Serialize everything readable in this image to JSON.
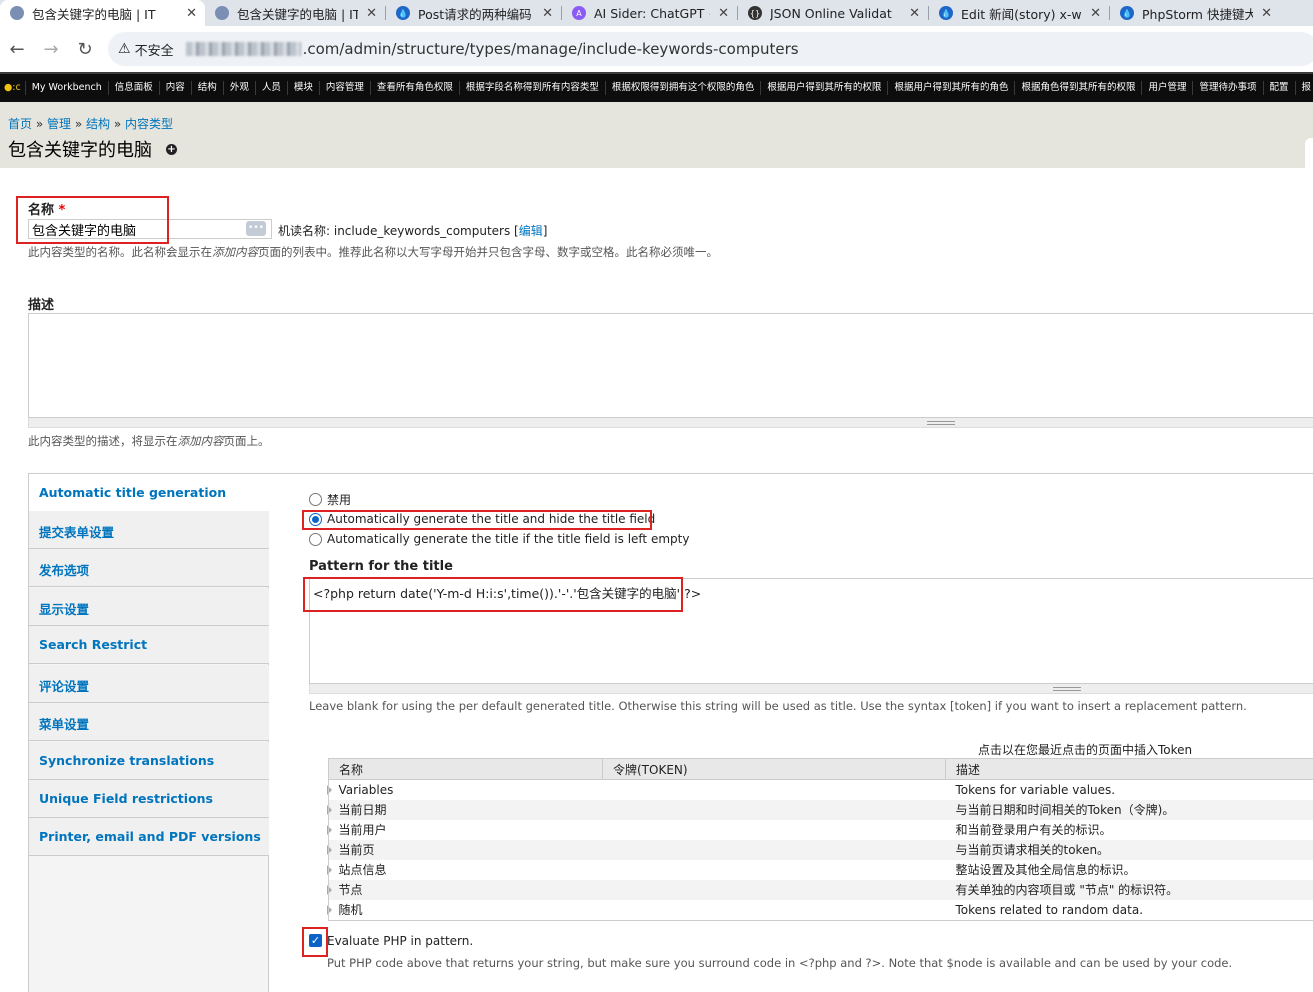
{
  "browser": {
    "tabs": [
      {
        "title": "包含关键字的电脑 | IT",
        "active": true,
        "favicon": "site-icon"
      },
      {
        "title": "包含关键字的电脑 | IT",
        "active": false,
        "favicon": "site-icon"
      },
      {
        "title": "Post请求的两种编码",
        "active": false,
        "favicon": "drupal-icon"
      },
      {
        "title": "AI Sider: ChatGPT +",
        "active": false,
        "favicon": "sider-icon"
      },
      {
        "title": "JSON Online Validat",
        "active": false,
        "favicon": "json-icon"
      },
      {
        "title": "Edit 新闻(story) x-w",
        "active": false,
        "favicon": "drupal-icon"
      },
      {
        "title": "PhpStorm 快捷键大全",
        "active": false,
        "favicon": "drupal-icon"
      }
    ],
    "insecure_label": "不安全",
    "url": ".com/admin/structure/types/manage/include-keywords-computers"
  },
  "admin_menu": [
    "My Workbench",
    "信息面板",
    "内容",
    "结构",
    "外观",
    "人员",
    "模块",
    "内容管理",
    "查看所有角色权限",
    "根据字段名称得到所有内容类型",
    "根据权限得到拥有这个权限的角色",
    "根据用户得到其所有的权限",
    "根据用户得到其所有的角色",
    "根据角色得到其所有的权限",
    "用户管理",
    "管理待办事项",
    "配置",
    "报"
  ],
  "breadcrumb": {
    "items": [
      "首页",
      "管理",
      "结构",
      "内容类型"
    ],
    "separator": " » "
  },
  "page_title": "包含关键字的电脑",
  "name_field": {
    "label": "名称",
    "required_marker": "*",
    "value": "包含关键字的电脑",
    "machine_name_prefix": "机读名称: ",
    "machine_name": "include_keywords_computers",
    "edit_link": "编辑",
    "desc_before": "此内容类型的名称。此名称会显示在",
    "desc_em": "添加内容",
    "desc_after": "页面的列表中。推荐此名称以大写字母开始并只包含字母、数字或空格。此名称必须唯一。"
  },
  "description_field": {
    "label": "描述",
    "value": "",
    "desc_before": "此内容类型的描述，将显示在",
    "desc_em": "添加内容",
    "desc_after": "页面上。"
  },
  "vertical_tabs": [
    "Automatic title generation",
    "提交表单设置",
    "发布选项",
    "显示设置",
    "Search Restrict",
    "评论设置",
    "菜单设置",
    "Synchronize translations",
    "Unique Field restrictions",
    "Printer, email and PDF versions"
  ],
  "auto_title": {
    "options": [
      {
        "label": "禁用",
        "checked": false
      },
      {
        "label": "Automatically generate the title and hide the title field",
        "checked": true
      },
      {
        "label": "Automatically generate the title if the title field is left empty",
        "checked": false
      }
    ],
    "pattern_label": "Pattern for the title",
    "pattern_value": "<?php return date('Y-m-d H:i:s',time()).'-'.'包含关键字的电脑' ?>",
    "pattern_desc": "Leave blank for using the per default generated title. Otherwise this string will be used as title. Use the syntax [token] if you want to insert a replacement pattern.",
    "token_hint": "点击以在您最近点击的页面中插入Token",
    "token_table": {
      "headers": [
        "名称",
        "令牌(TOKEN)",
        "描述"
      ],
      "rows": [
        {
          "name": "Variables",
          "token": "",
          "desc": "Tokens for variable values."
        },
        {
          "name": "当前日期",
          "token": "",
          "desc": "与当前日期和时间相关的Token（令牌)。"
        },
        {
          "name": "当前用户",
          "token": "",
          "desc": "和当前登录用户有关的标识。"
        },
        {
          "name": "当前页",
          "token": "",
          "desc": "与当前页请求相关的token。"
        },
        {
          "name": "站点信息",
          "token": "",
          "desc": "整站设置及其他全局信息的标识。"
        },
        {
          "name": "节点",
          "token": "",
          "desc": "有关单独的内容项目或 \"节点\" 的标识符。"
        },
        {
          "name": "随机",
          "token": "",
          "desc": "Tokens related to random data."
        }
      ]
    },
    "evaluate_php": {
      "checked": true,
      "label": "Evaluate PHP in pattern.",
      "desc": "Put PHP code above that returns your string, but make sure you surround code in <?php and ?>. Note that $node is available and can be used by your code."
    }
  },
  "colors": {
    "link": "#0074bd",
    "highlight_box": "#dd2222",
    "admin_menu_bg": "#0d0d0d",
    "header_bg": "#e5e4dd"
  }
}
